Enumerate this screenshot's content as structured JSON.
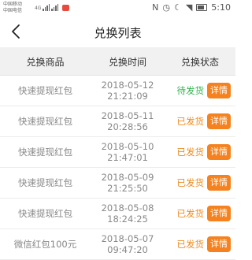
{
  "statusbar": {
    "carrier1": "中国移动",
    "carrier2": "中国电信",
    "network": "4G",
    "time": "5:10"
  },
  "header": {
    "title": "兑换列表"
  },
  "columns": {
    "name": "兑换商品",
    "time": "兑换时间",
    "status": "兑换状态"
  },
  "detail_label": "详情",
  "rows": [
    {
      "name": "快速提现红包",
      "date": "2018-05-12",
      "time": "21:21:09",
      "status": "待发货",
      "kind": "pending"
    },
    {
      "name": "快速提现红包",
      "date": "2018-05-11",
      "time": "20:28:56",
      "status": "已发货",
      "kind": "shipped"
    },
    {
      "name": "快速提现红包",
      "date": "2018-05-10",
      "time": "21:47:01",
      "status": "已发货",
      "kind": "shipped"
    },
    {
      "name": "快速提现红包",
      "date": "2018-05-09",
      "time": "21:25:50",
      "status": "已发货",
      "kind": "shipped"
    },
    {
      "name": "快速提现红包",
      "date": "2018-05-08",
      "time": "18:24:25",
      "status": "已发货",
      "kind": "shipped"
    },
    {
      "name": "微信红包100元",
      "date": "2018-05-07",
      "time": "09:47:20",
      "status": "已发货",
      "kind": "shipped"
    }
  ]
}
